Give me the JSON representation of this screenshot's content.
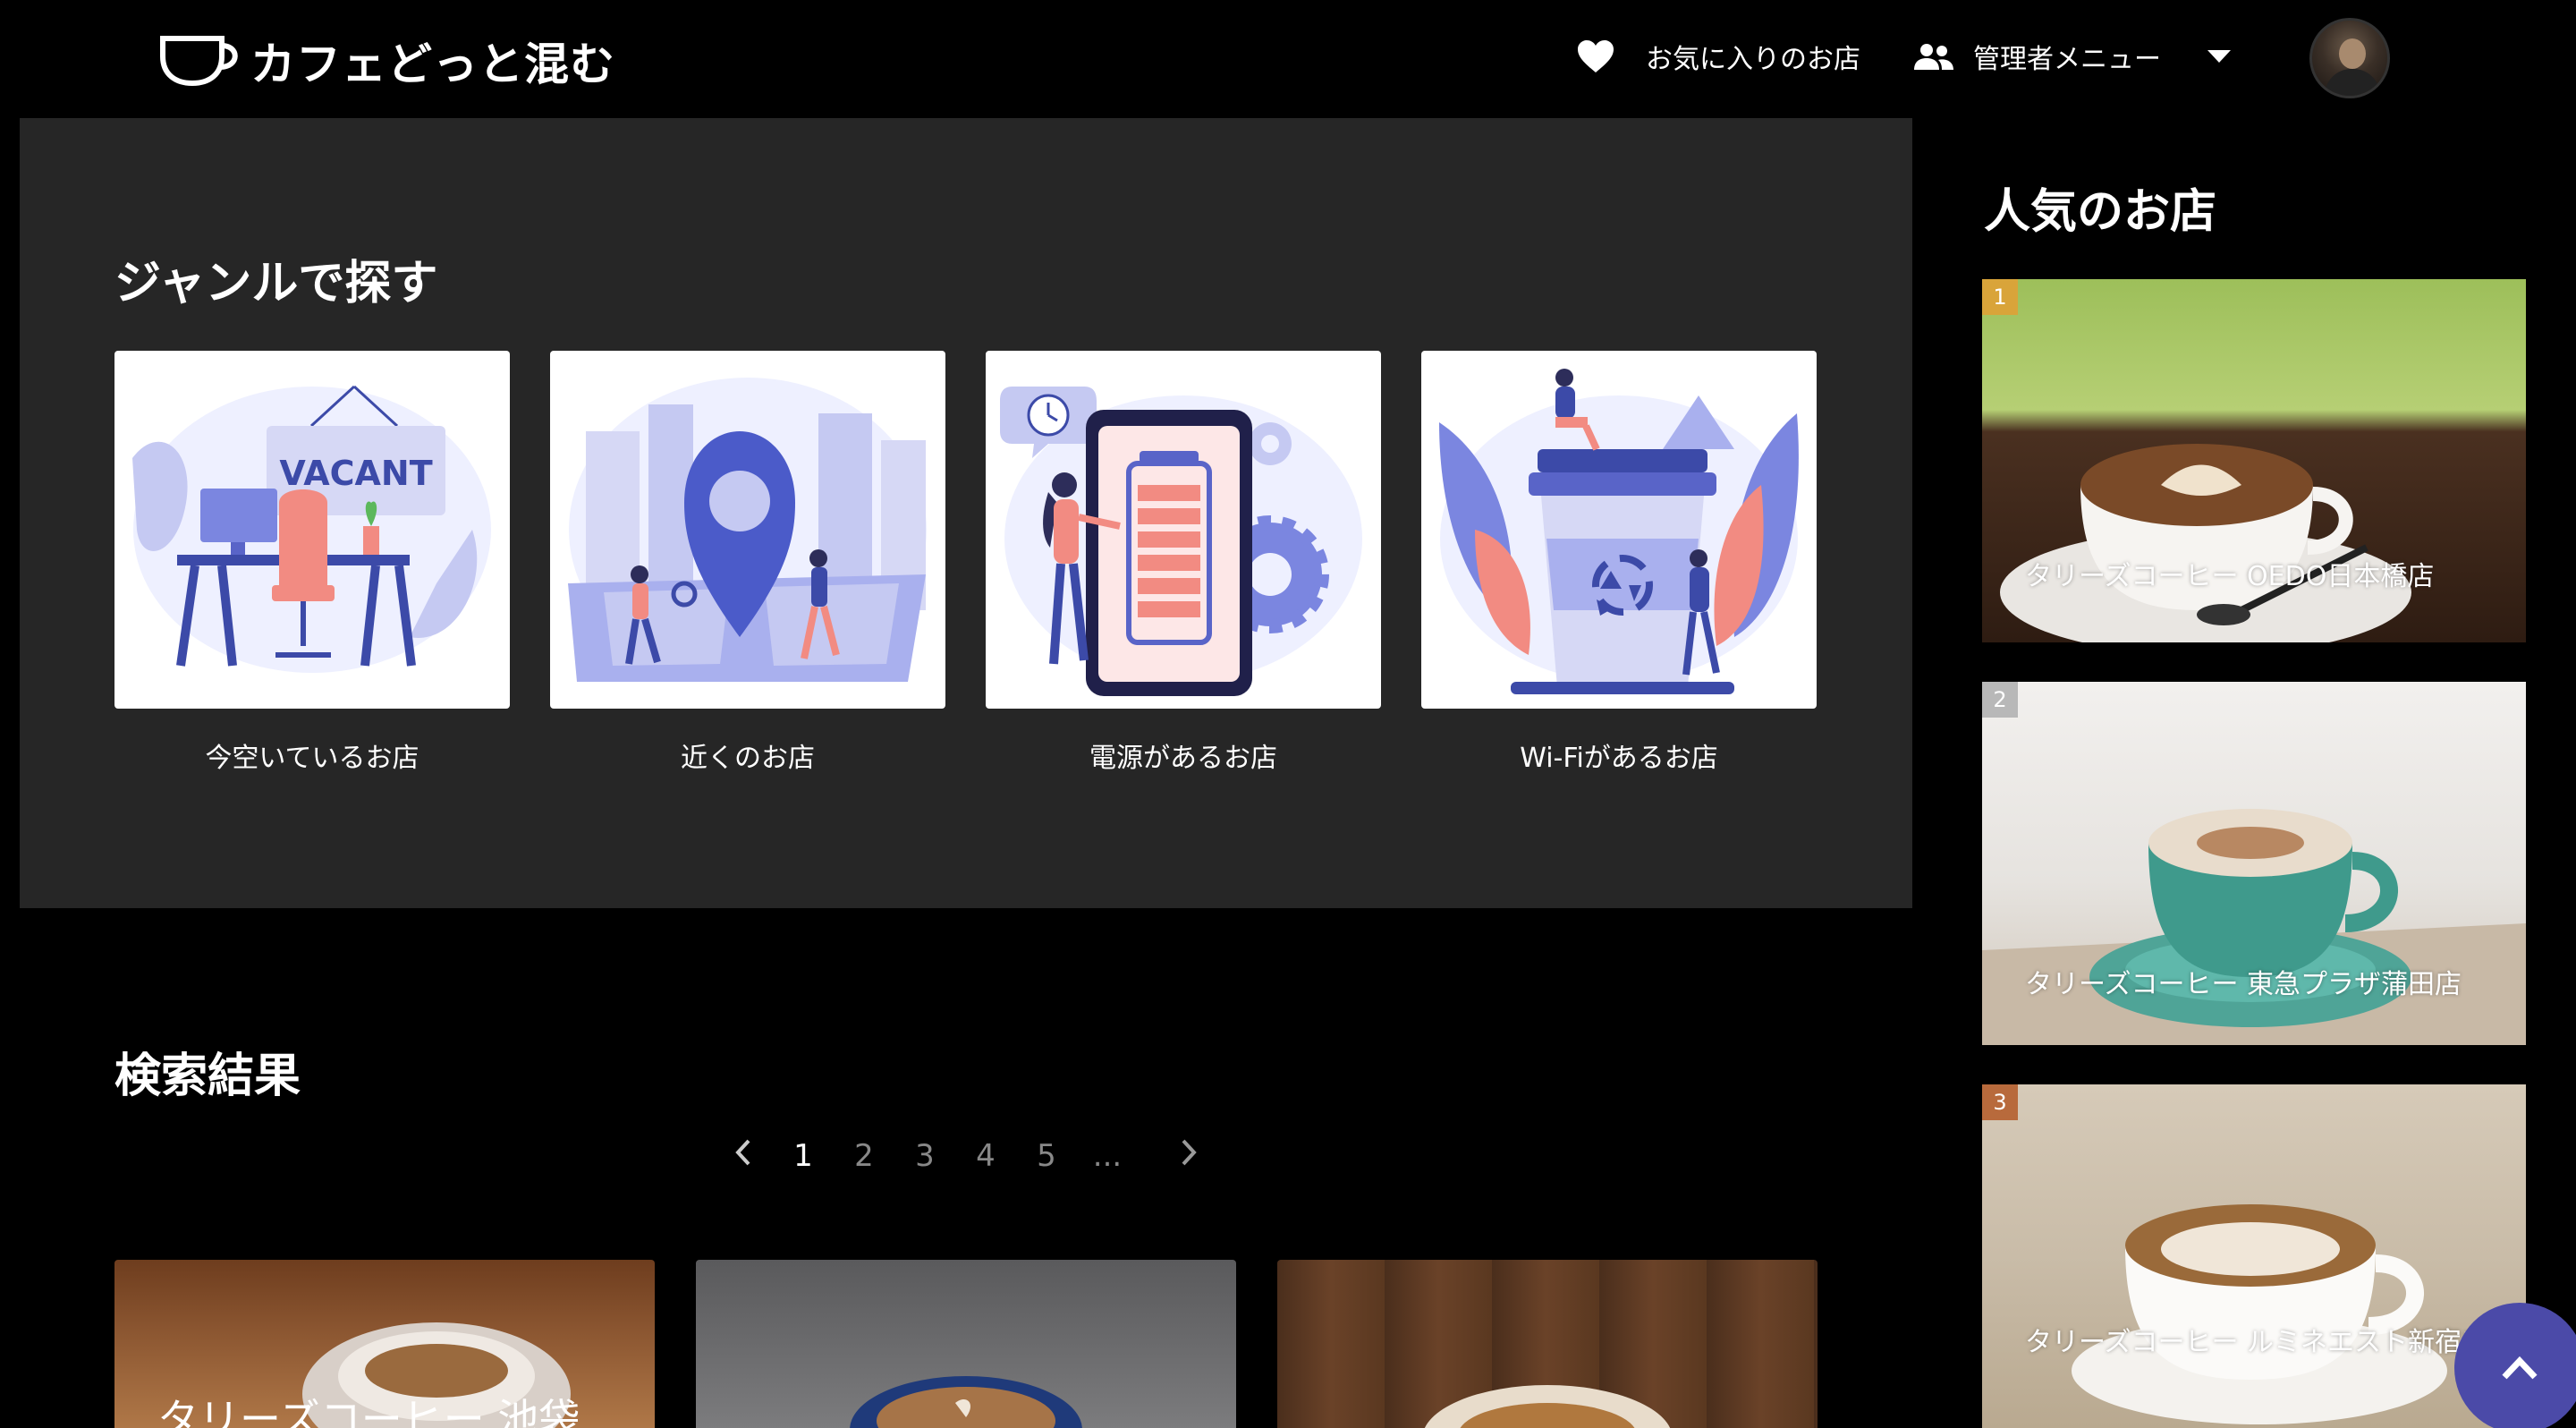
{
  "header": {
    "logo_text": "カフェどっと混む",
    "favorites_label": "お気に入りのお店",
    "admin_menu_label": "管理者メニュー"
  },
  "genre": {
    "title": "ジャンルで探す",
    "items": [
      {
        "label": "今空いているお店",
        "illustration": "vacant-desk-illustration",
        "sign_text": "VACANT"
      },
      {
        "label": "近くのお店",
        "illustration": "map-pin-city-illustration"
      },
      {
        "label": "電源があるお店",
        "illustration": "phone-battery-illustration"
      },
      {
        "label": "Wi-Fiがあるお店",
        "illustration": "recycle-cup-illustration"
      }
    ]
  },
  "results": {
    "title": "検索結果",
    "pagination": {
      "prev_icon": "chevron-left-icon",
      "pages": [
        "1",
        "2",
        "3",
        "4",
        "5",
        "..."
      ],
      "current": "1",
      "next_icon": "chevron-right-icon"
    },
    "cards": [
      {
        "name": "タリーズコーヒー 池袋"
      },
      {
        "name": ""
      },
      {
        "name": ""
      }
    ]
  },
  "popular": {
    "title": "人気のお店",
    "items": [
      {
        "rank": "1",
        "name": "タリーズコーヒー OEDO日本橋店",
        "badge_color": "#d9a43a"
      },
      {
        "rank": "2",
        "name": "タリーズコーヒー 東急プラザ蒲田店",
        "badge_color": "#b8b8b8"
      },
      {
        "rank": "3",
        "name": "タリーズコーヒー ルミネエスト新宿店",
        "badge_color": "#b86a3c"
      }
    ]
  },
  "colors": {
    "background": "#000000",
    "panel": "#262626",
    "accent": "#4b4aa8"
  }
}
